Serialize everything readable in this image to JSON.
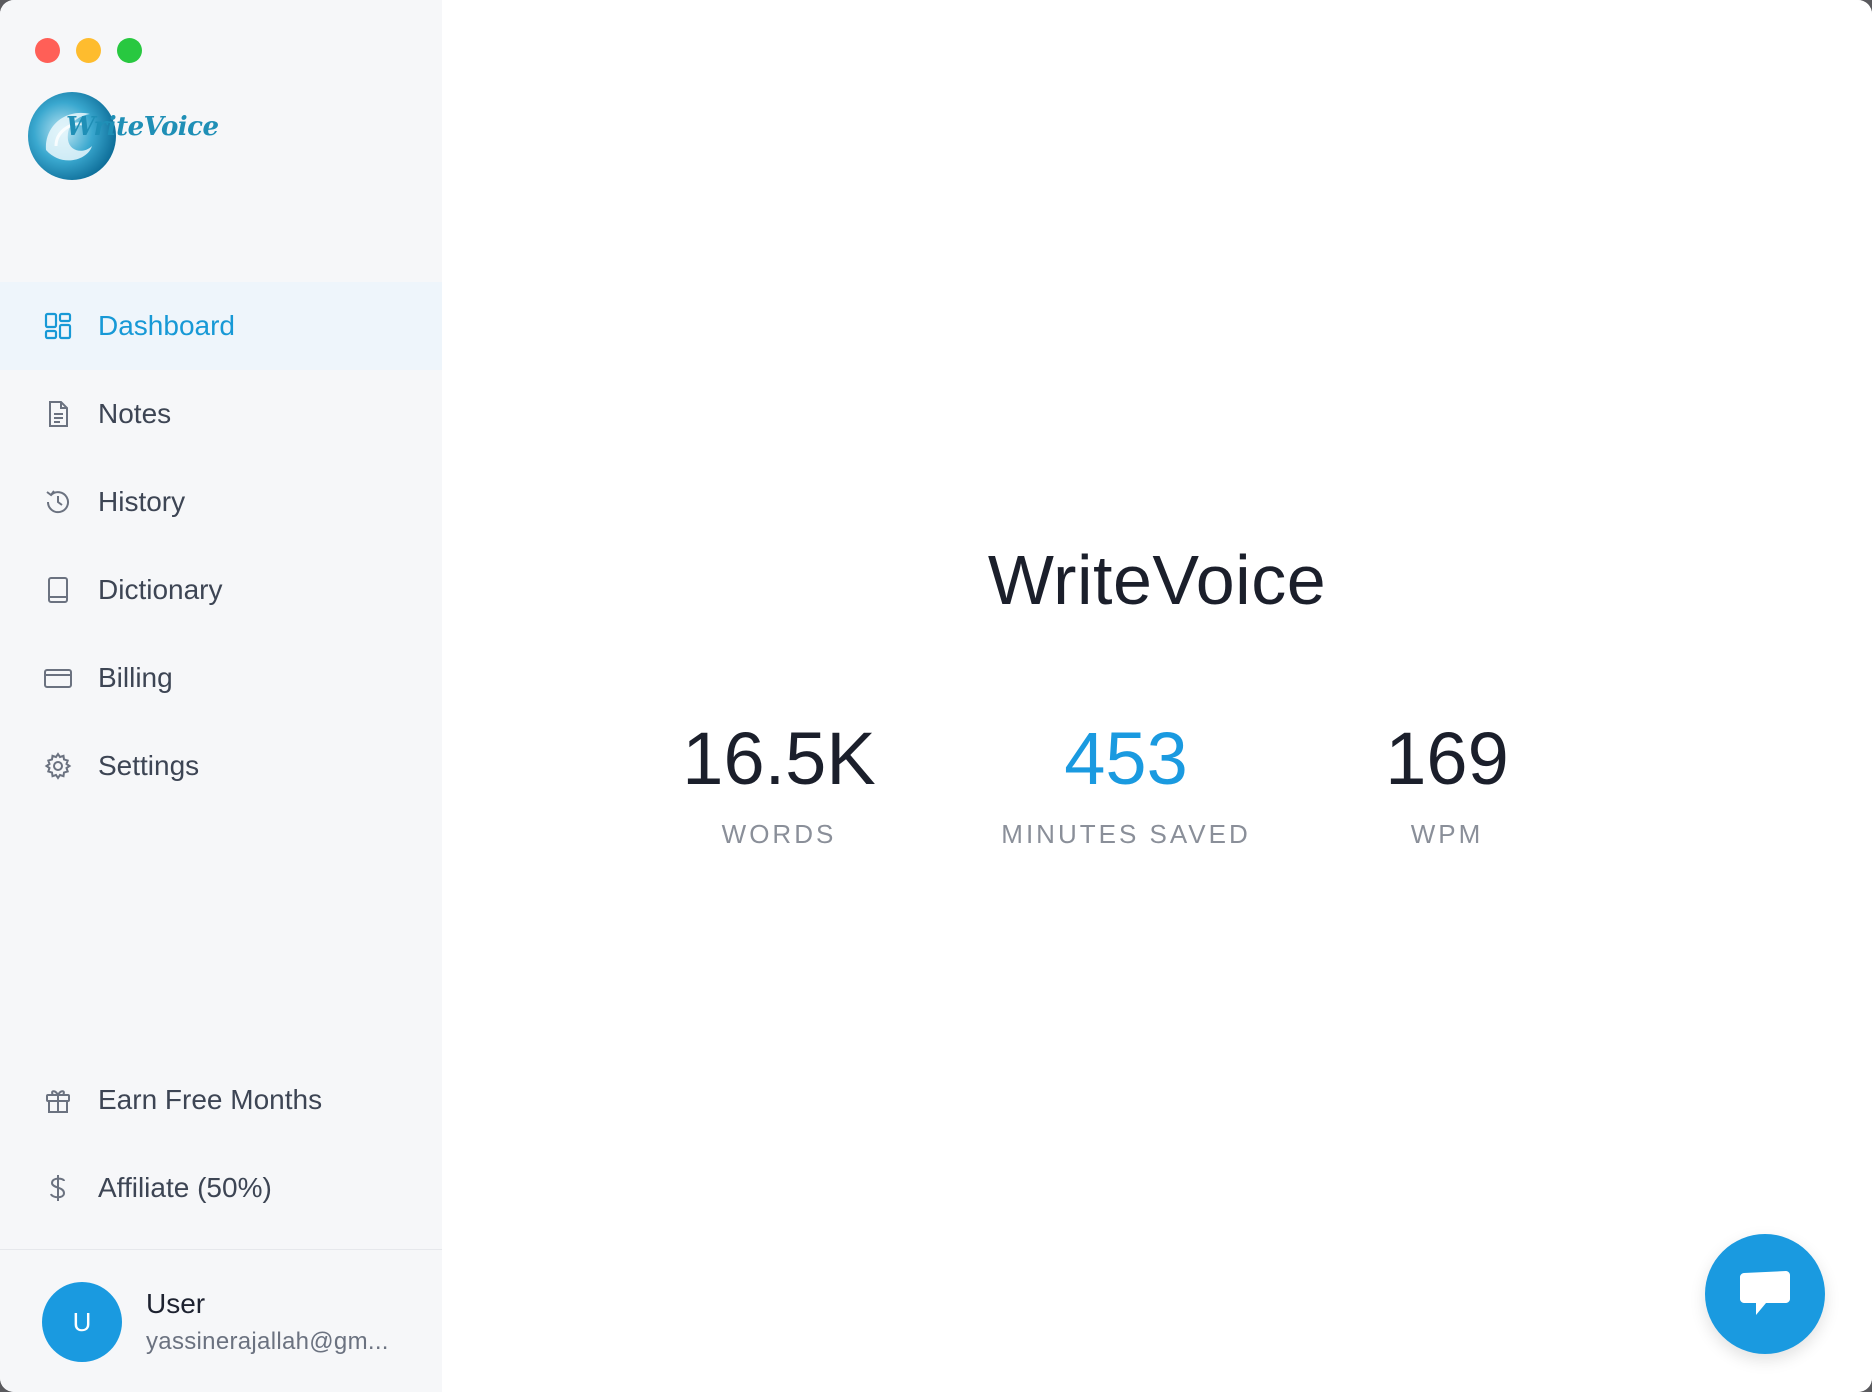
{
  "window": {
    "controls": [
      "close",
      "minimize",
      "zoom"
    ],
    "control_colors": [
      "#ff5f57",
      "#febc2e",
      "#28c840"
    ]
  },
  "brand": {
    "logo_text": "WriteVoice",
    "logo_icon": "wave-logo-icon",
    "accent_color": "#1a9ae0"
  },
  "sidebar": {
    "items": [
      {
        "label": "Dashboard",
        "icon": "dashboard-grid-icon",
        "active": true
      },
      {
        "label": "Notes",
        "icon": "document-icon",
        "active": false
      },
      {
        "label": "History",
        "icon": "history-clock-icon",
        "active": false
      },
      {
        "label": "Dictionary",
        "icon": "book-icon",
        "active": false
      },
      {
        "label": "Billing",
        "icon": "credit-card-icon",
        "active": false
      },
      {
        "label": "Settings",
        "icon": "gear-icon",
        "active": false
      }
    ],
    "bottom_items": [
      {
        "label": "Earn Free Months",
        "icon": "gift-icon"
      },
      {
        "label": "Affiliate (50%)",
        "icon": "dollar-icon"
      }
    ]
  },
  "user": {
    "initial": "U",
    "name": "User",
    "email": "yassinerajallah@gm..."
  },
  "main": {
    "title": "WriteVoice",
    "stats": [
      {
        "value": "16.5K",
        "label": "WORDS"
      },
      {
        "value": "453",
        "label": "MINUTES SAVED"
      },
      {
        "value": "169",
        "label": "WPM"
      }
    ]
  },
  "chat": {
    "icon": "chat-bubble-icon"
  }
}
